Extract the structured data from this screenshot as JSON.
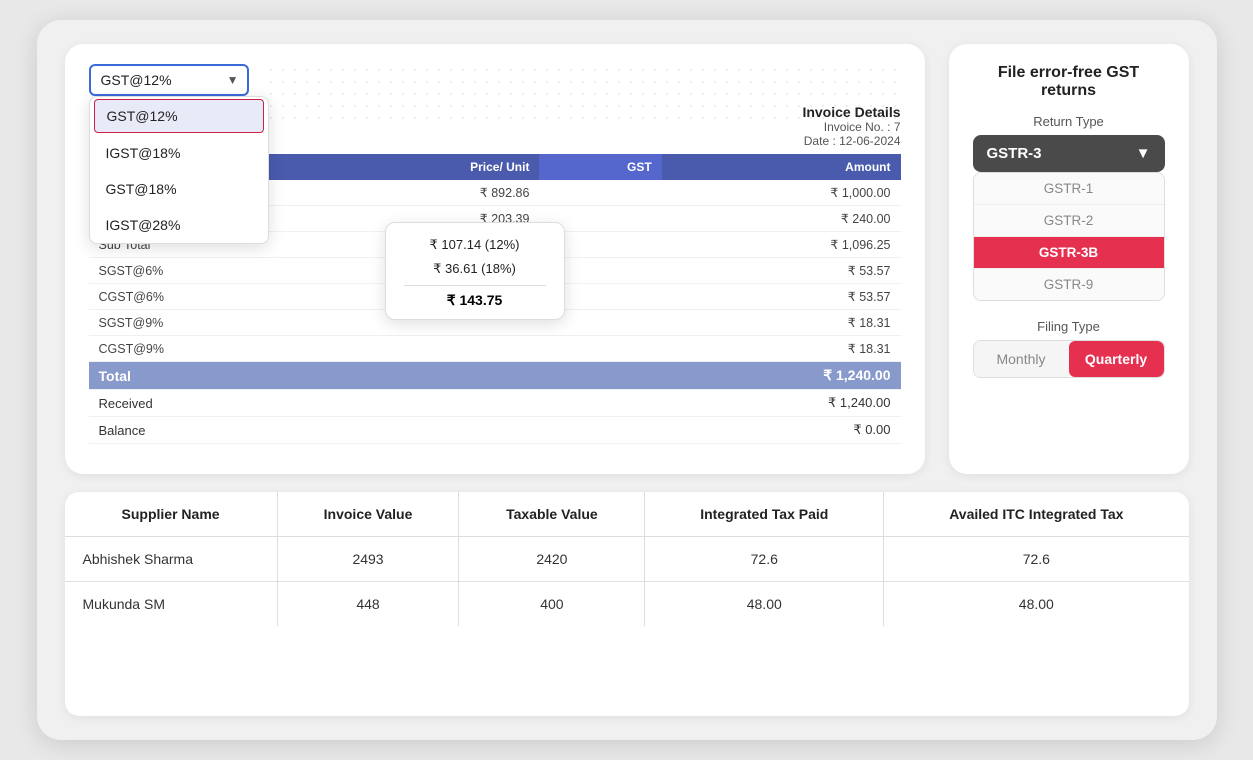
{
  "invoice_card": {
    "dropdown": {
      "selected": "GST@12%",
      "arrow": "▼",
      "options": [
        "GST@12%",
        "IGST@18%",
        "GST@18%",
        "IGST@28%"
      ]
    },
    "invoice_details": {
      "title": "Invoice Details",
      "invoice_no": "Invoice No. : 7",
      "date": "Date : 12-06-2024"
    },
    "table": {
      "headers": [
        "",
        "Price/ Unit",
        "GST",
        "Amount"
      ],
      "rows": [
        {
          "label": "",
          "price": "₹ 892.86",
          "gst": "",
          "amount": "₹ 1,000.00"
        },
        {
          "label": "",
          "price": "₹ 203.39",
          "gst": "",
          "amount": "₹ 240.00"
        }
      ],
      "subtotal_label": "Sub Total",
      "subtotal_amount": "₹ 1,096.25",
      "tax_rows": [
        {
          "label": "SGST@6%",
          "amount": "₹ 53.57"
        },
        {
          "label": "CGST@6%",
          "amount": "₹ 53.57"
        },
        {
          "label": "SGST@9%",
          "amount": "₹ 18.31"
        },
        {
          "label": "CGST@9%",
          "amount": "₹ 18.31"
        }
      ],
      "total_label": "Total",
      "total_amount": "₹ 1,240.00",
      "received_label": "Received",
      "received_amount": "₹ 1,240.00",
      "balance_label": "Balance",
      "balance_amount": "₹ 0.00"
    },
    "gst_popup": {
      "items": [
        {
          "label": "₹ 107.14 (12%)"
        },
        {
          "label": "₹ 36.61 (18%)"
        }
      ],
      "total": "₹ 143.75"
    }
  },
  "gst_returns": {
    "title": "File error-free GST returns",
    "return_type_label": "Return Type",
    "return_dropdown_selected": "GSTR-3",
    "dropdown_arrow": "▼",
    "return_options": [
      "GSTR-1",
      "GSTR-2",
      "GSTR-3B",
      "GSTR-9"
    ],
    "filing_type_label": "Filing Type",
    "filing_buttons": [
      {
        "label": "Monthly",
        "active": false
      },
      {
        "label": "Quarterly",
        "active": true
      }
    ]
  },
  "data_table": {
    "headers": [
      "Supplier Name",
      "Invoice Value",
      "Taxable Value",
      "Integrated Tax Paid",
      "Availed ITC Integrated Tax"
    ],
    "rows": [
      {
        "supplier": "Abhishek Sharma",
        "invoice_value": "2493",
        "taxable_value": "2420",
        "integrated_tax": "72.6",
        "availed_itc": "72.6"
      },
      {
        "supplier": "Mukunda SM",
        "invoice_value": "448",
        "taxable_value": "400",
        "integrated_tax": "48.00",
        "availed_itc": "48.00"
      }
    ]
  }
}
